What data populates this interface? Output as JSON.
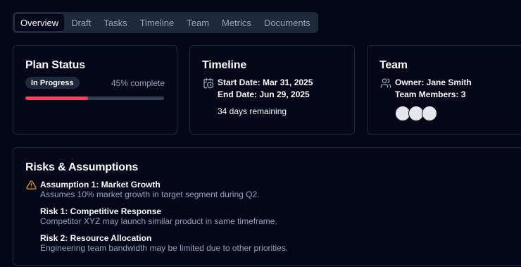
{
  "tabs": [
    "Overview",
    "Draft",
    "Tasks",
    "Timeline",
    "Team",
    "Metrics",
    "Documents"
  ],
  "plan": {
    "title": "Plan Status",
    "status": "In Progress",
    "complete_text": "45% complete",
    "progress": 0.45,
    "progress_color": "#f43f5e"
  },
  "timeline": {
    "title": "Timeline",
    "icon": "calendar-clock-icon",
    "start": "Start Date: Mar 31, 2025",
    "end": "End Date: Jun 29, 2025",
    "remaining": "34 days remaining"
  },
  "team": {
    "title": "Team",
    "icon": "users-icon",
    "owner": "Owner: Jane Smith",
    "members": "Team Members: 3"
  },
  "risks": {
    "title": "Risks & Assumptions",
    "icon": "warning-triangle-icon",
    "icon_color": "#f59e0b",
    "items": [
      {
        "title": "Assumption 1: Market Growth",
        "desc": "Assumes 10% market growth in target segment during Q2."
      },
      {
        "title": "Risk 1: Competitive Response",
        "desc": "Competitor XYZ may launch similar product in same timeframe."
      },
      {
        "title": "Risk 2: Resource Allocation",
        "desc": "Engineering team bandwidth may be limited due to other priorities."
      }
    ]
  }
}
